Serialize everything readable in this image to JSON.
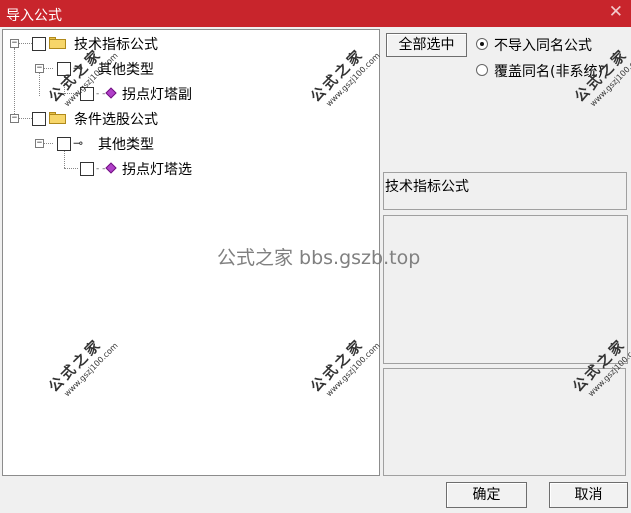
{
  "window": {
    "title": "导入公式",
    "close_glyph": "✕"
  },
  "tree": {
    "groups": [
      {
        "label": "技术指标公式",
        "expander": "−",
        "child": {
          "label": "其他类型",
          "expander": "−",
          "leaf": {
            "label": "拐点灯塔副"
          }
        }
      },
      {
        "label": "条件选股公式",
        "expander": "−",
        "child": {
          "label": "其他类型",
          "expander": "−",
          "leaf": {
            "label": "拐点灯塔选"
          }
        }
      }
    ],
    "key_glyph": "⊸",
    "leaf_dash": "- -"
  },
  "options": {
    "select_all_label": "全部选中",
    "radio_skip_label": "不导入同名公式",
    "radio_overwrite_label": "覆盖同名(非系统)",
    "selected": "skip"
  },
  "info": {
    "title_text": "技术指标公式"
  },
  "footer": {
    "ok_label": "确定",
    "cancel_label": "取消"
  },
  "watermarks": {
    "stamp_text": "公式之家",
    "stamp_url": "www.gszj100.com",
    "center_text": "公式之家 bbs.gszb.top"
  },
  "icons": [
    "close-icon",
    "folder-icon",
    "key-icon",
    "gem-icon",
    "expander-icon",
    "checkbox-icon",
    "radio-icon"
  ],
  "colors": {
    "titlebar": "#c8252c",
    "title_text": "#ffffff",
    "gem": "#b040c8",
    "folder": "#f7d66a"
  }
}
